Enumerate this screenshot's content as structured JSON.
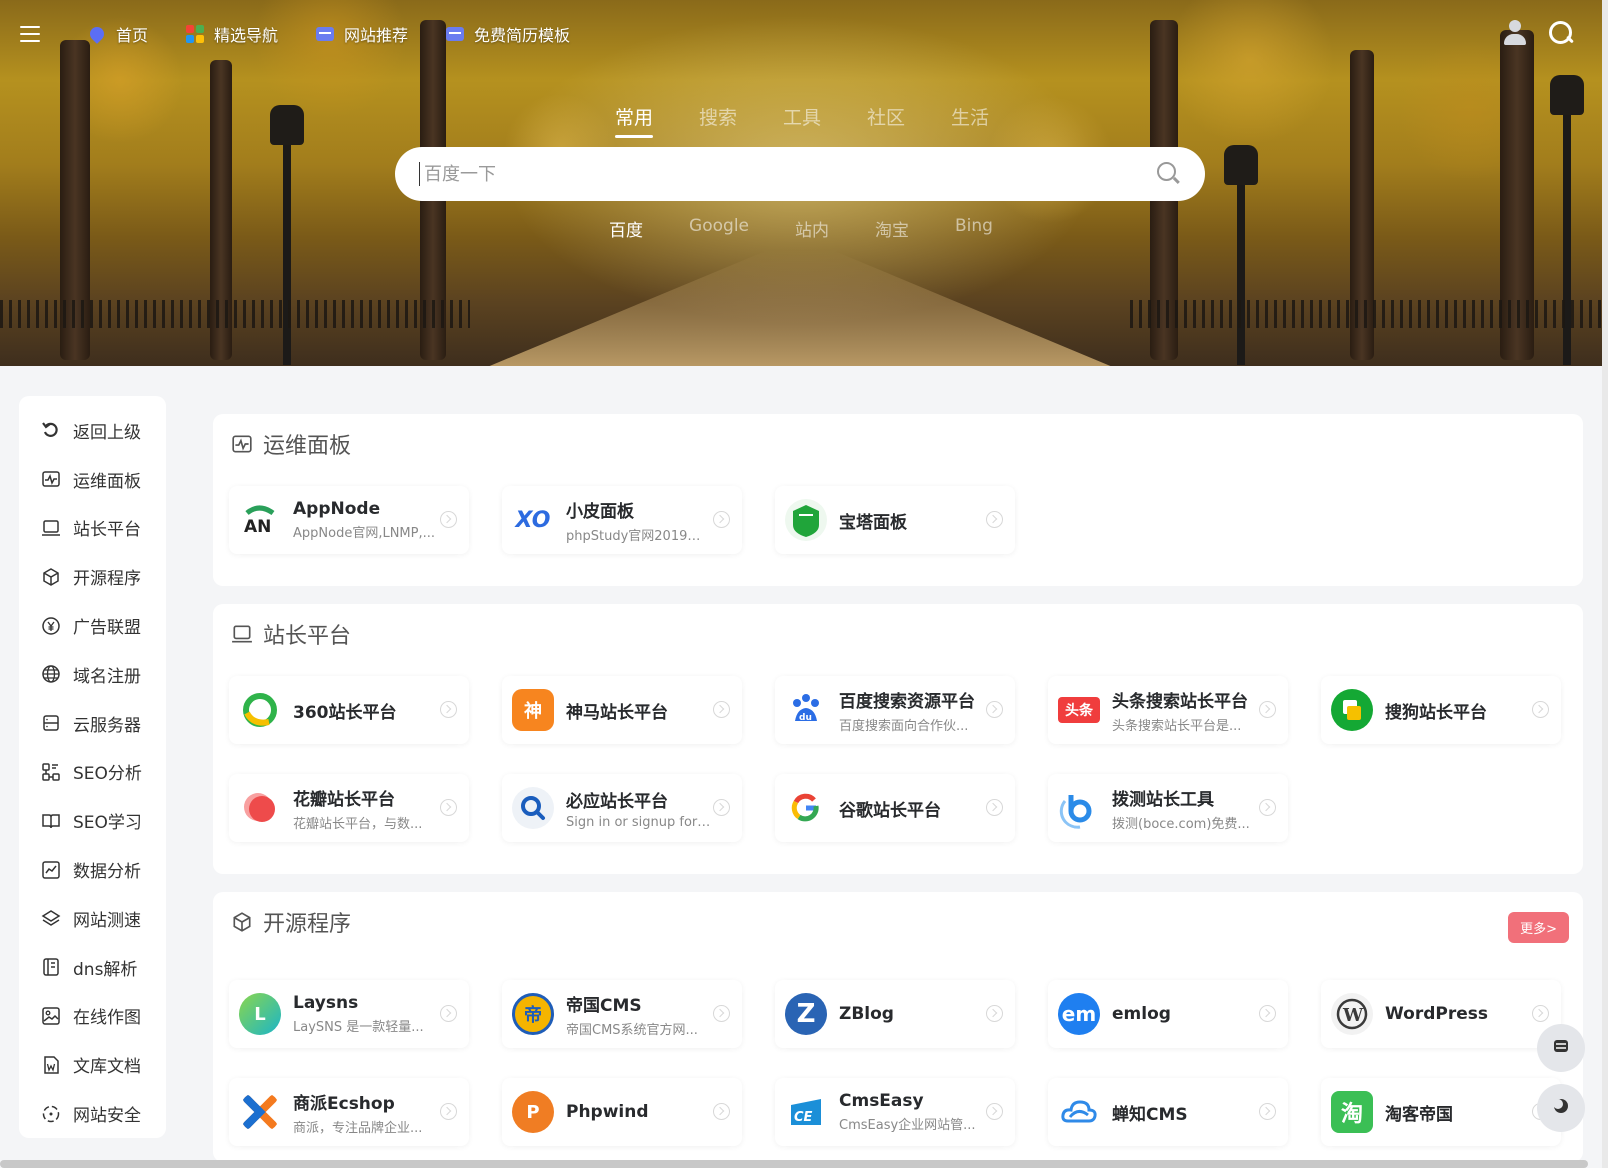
{
  "nav": {
    "items": [
      {
        "label": "首页",
        "icon": "home-icon"
      },
      {
        "label": "精选导航",
        "icon": "grid-icon"
      },
      {
        "label": "网站推荐",
        "icon": "folder-icon"
      },
      {
        "label": "免费简历模板",
        "icon": "folder-icon"
      }
    ]
  },
  "search": {
    "tabs": [
      "常用",
      "搜索",
      "工具",
      "社区",
      "生活"
    ],
    "active_tab": "常用",
    "placeholder": "百度一下",
    "engines": [
      "百度",
      "Google",
      "站内",
      "淘宝",
      "Bing"
    ],
    "active_engine": "百度"
  },
  "sidebar": {
    "items": [
      {
        "label": "返回上级",
        "icon": "back-icon"
      },
      {
        "label": "运维面板",
        "icon": "monitor-icon"
      },
      {
        "label": "站长平台",
        "icon": "laptop-icon"
      },
      {
        "label": "开源程序",
        "icon": "cube-icon"
      },
      {
        "label": "广告联盟",
        "icon": "yen-icon"
      },
      {
        "label": "域名注册",
        "icon": "globe-icon"
      },
      {
        "label": "云服务器",
        "icon": "server-icon"
      },
      {
        "label": "SEO分析",
        "icon": "sitemap-icon"
      },
      {
        "label": "SEO学习",
        "icon": "book-icon"
      },
      {
        "label": "数据分析",
        "icon": "chart-icon"
      },
      {
        "label": "网站测速",
        "icon": "layers-icon"
      },
      {
        "label": "dns解析",
        "icon": "doc-icon"
      },
      {
        "label": "在线作图",
        "icon": "image-icon"
      },
      {
        "label": "文库文档",
        "icon": "word-icon"
      },
      {
        "label": "网站安全",
        "icon": "shield-icon"
      }
    ]
  },
  "sections": [
    {
      "title": "运维面板",
      "icon": "monitor-icon",
      "tiles": [
        {
          "name": "AppNode",
          "desc": "AppNode官网,LNMP,...",
          "logo": "AN",
          "color": "#1e8a4c"
        },
        {
          "name": "小皮面板",
          "desc": "phpStudy官网2019正...",
          "logo": "XO",
          "color": "#2d6be0"
        },
        {
          "name": "宝塔面板",
          "desc": "",
          "logo": "BT",
          "color": "#20a53a"
        }
      ]
    },
    {
      "title": "站长平台",
      "icon": "laptop-icon",
      "tiles": [
        {
          "name": "360站长平台",
          "desc": "",
          "logo": "360",
          "color": "#2fb34a"
        },
        {
          "name": "神马站长平台",
          "desc": "",
          "logo": "神",
          "color": "#f7851f"
        },
        {
          "name": "百度搜索资源平台",
          "desc": "百度搜索面向合作伙...",
          "logo": "du",
          "color": "#2b6de5"
        },
        {
          "name": "头条搜索站长平台",
          "desc": "头条搜索站长平台是...",
          "logo": "头条",
          "color": "#f03d3d"
        },
        {
          "name": "搜狗站长平台",
          "desc": "",
          "logo": "S",
          "color": "#14a834"
        },
        {
          "name": "花瓣站长平台",
          "desc": "花瓣站长平台，与数...",
          "logo": "",
          "color": "#ee4b4b"
        },
        {
          "name": "必应站长平台",
          "desc": "Sign in or signup for ...",
          "logo": "Q",
          "color": "#1a5dbd"
        },
        {
          "name": "谷歌站长平台",
          "desc": "",
          "logo": "G",
          "color": "#4285f4"
        },
        {
          "name": "拨测站长工具",
          "desc": "拨测(boce.com)免费...",
          "logo": "b",
          "color": "#2b8be8"
        }
      ]
    },
    {
      "title": "开源程序",
      "icon": "cube-icon",
      "more": "更多>",
      "tiles": [
        {
          "name": "Laysns",
          "desc": "LaySNS 是一款轻量...",
          "logo": "L",
          "color": "#1bb5c8"
        },
        {
          "name": "帝国CMS",
          "desc": "帝国CMS系统官方网...",
          "logo": "帝",
          "color": "#f5b400"
        },
        {
          "name": "ZBlog",
          "desc": "",
          "logo": "Z",
          "color": "#2a64b4"
        },
        {
          "name": "emlog",
          "desc": "",
          "logo": "em",
          "color": "#1f7ff0"
        },
        {
          "name": "WordPress",
          "desc": "",
          "logo": "W",
          "color": "#3a3a3a"
        },
        {
          "name": "商派Ecshop",
          "desc": "商派，专注品牌企业...",
          "logo": "X",
          "color": "#f47a1f"
        },
        {
          "name": "Phpwind",
          "desc": "",
          "logo": "P",
          "color": "#f07d23"
        },
        {
          "name": "CmsEasy",
          "desc": "CmsEasy企业网站管...",
          "logo": "CE",
          "color": "#1b8fd8"
        },
        {
          "name": "蝉知CMS",
          "desc": "",
          "logo": "☁",
          "color": "#2f8ae8"
        },
        {
          "name": "淘客帝国",
          "desc": "",
          "logo": "淘",
          "color": "#3bbf55"
        }
      ]
    }
  ]
}
